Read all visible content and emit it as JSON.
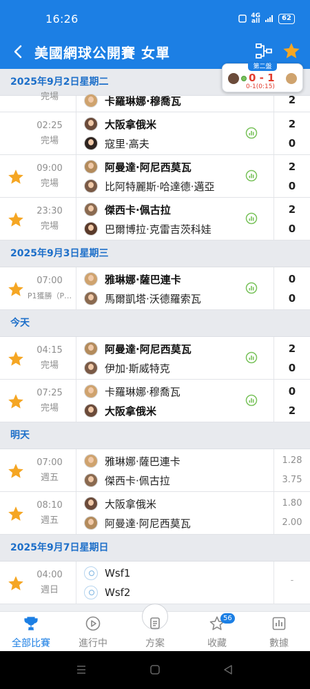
{
  "status_bar": {
    "time": "16:26",
    "network_top": "4G",
    "network_bottom": "all",
    "battery": "62"
  },
  "header": {
    "title": "美國網球公開賽 女單"
  },
  "live_widget": {
    "set_label": "第二盤",
    "score": "0 - 1",
    "sub": "0-1(0:15)"
  },
  "sections": [
    {
      "date": "2025年9月2日星期二",
      "rows": [
        {
          "partial": true,
          "favorite": false,
          "time": "",
          "status": "完場",
          "p1": {
            "name": "",
            "bold": false,
            "avatar": "a5"
          },
          "p2": {
            "name": "卡羅琳娜·穆喬瓦",
            "bold": true,
            "avatar": "a5"
          },
          "score1": "",
          "score2": "2"
        },
        {
          "favorite": false,
          "time": "02:25",
          "status": "完場",
          "p1": {
            "name": "大阪拿俄米",
            "bold": true,
            "avatar": "a1"
          },
          "p2": {
            "name": "寇里·高夫",
            "bold": false,
            "avatar": "a3"
          },
          "stats": true,
          "score1": "2",
          "score2": "0"
        },
        {
          "favorite": true,
          "time": "09:00",
          "status": "完場",
          "p1": {
            "name": "阿曼達·阿尼西莫瓦",
            "bold": true,
            "avatar": "a2"
          },
          "p2": {
            "name": "比阿特麗斯·哈達德·邁亞",
            "bold": false,
            "avatar": "a6"
          },
          "stats": true,
          "score1": "2",
          "score2": "0"
        },
        {
          "favorite": true,
          "time": "23:30",
          "status": "完場",
          "p1": {
            "name": "傑西卡·佩古拉",
            "bold": true,
            "avatar": "a4"
          },
          "p2": {
            "name": "巴爾博拉·克雷吉茨科娃",
            "bold": false,
            "avatar": "a7"
          },
          "stats": true,
          "score1": "2",
          "score2": "0"
        }
      ]
    },
    {
      "date": "2025年9月3日星期三",
      "rows": [
        {
          "favorite": true,
          "time": "07:00",
          "status": "P1獲勝（P…",
          "status_small": true,
          "p1": {
            "name": "雅琳娜·薩巴連卡",
            "bold": true,
            "avatar": "a5"
          },
          "p2": {
            "name": "馬爾凱塔·沃德羅索瓦",
            "bold": false,
            "avatar": "a4"
          },
          "stats": true,
          "score1": "0",
          "score2": "0"
        }
      ]
    },
    {
      "date": "今天",
      "rows": [
        {
          "favorite": true,
          "time": "04:15",
          "status": "完場",
          "p1": {
            "name": "阿曼達·阿尼西莫瓦",
            "bold": true,
            "avatar": "a2"
          },
          "p2": {
            "name": "伊加·斯威特克",
            "bold": false,
            "avatar": "a6"
          },
          "stats": true,
          "score1": "2",
          "score2": "0"
        },
        {
          "favorite": true,
          "time": "07:25",
          "status": "完場",
          "p1": {
            "name": "卡羅琳娜·穆喬瓦",
            "bold": false,
            "avatar": "a5"
          },
          "p2": {
            "name": "大阪拿俄米",
            "bold": true,
            "avatar": "a1"
          },
          "stats": true,
          "score1": "0",
          "score2": "2"
        }
      ]
    },
    {
      "date": "明天",
      "rows": [
        {
          "favorite": true,
          "time": "07:00",
          "status": "週五",
          "p1": {
            "name": "雅琳娜·薩巴連卡",
            "bold": false,
            "avatar": "a5"
          },
          "p2": {
            "name": "傑西卡·佩古拉",
            "bold": false,
            "avatar": "a4"
          },
          "odds1": "1.28",
          "odds2": "3.75"
        },
        {
          "favorite": true,
          "time": "08:10",
          "status": "週五",
          "p1": {
            "name": "大阪拿俄米",
            "bold": false,
            "avatar": "a1"
          },
          "p2": {
            "name": "阿曼達·阿尼西莫瓦",
            "bold": false,
            "avatar": "a2"
          },
          "odds1": "1.80",
          "odds2": "2.00"
        }
      ]
    },
    {
      "date": "2025年9月7日星期日",
      "rows": [
        {
          "favorite": true,
          "time": "04:00",
          "status": "週日",
          "p1": {
            "name": "Wsf1",
            "bold": false,
            "avatar": "blank"
          },
          "p2": {
            "name": "Wsf2",
            "bold": false,
            "avatar": "blank"
          },
          "placeholder": "-"
        }
      ]
    }
  ],
  "bottom_nav": [
    {
      "label": "全部比賽",
      "icon": "trophy-icon",
      "active": true
    },
    {
      "label": "進行中",
      "icon": "play-circle-icon",
      "active": false
    },
    {
      "label": "方案",
      "icon": "document-icon",
      "active": false
    },
    {
      "label": "收藏",
      "icon": "star-outline-icon",
      "active": false,
      "badge": "56"
    },
    {
      "label": "數據",
      "icon": "bar-chart-icon",
      "active": false
    }
  ],
  "colors": {
    "primary": "#1c7fe4",
    "star": "#f5a623",
    "live_red": "#e23d2f",
    "stats_green": "#78c25a"
  }
}
